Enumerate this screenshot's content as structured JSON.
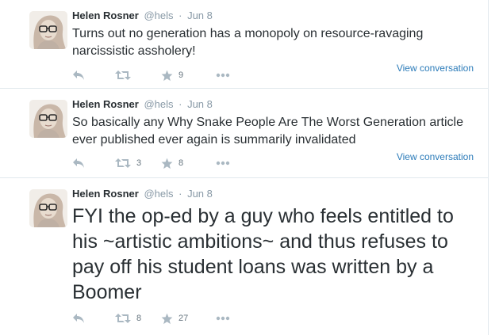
{
  "colors": {
    "name": "#292f33",
    "meta": "#8899a6",
    "link": "#2b7bb9",
    "action_icon": "#aab8c2",
    "divider": "#e1e8ed"
  },
  "tweets": [
    {
      "fullname": "Helen Rosner",
      "username": "@hels",
      "separator": "·",
      "time": "Jun 8",
      "text": "Turns out no generation has a monopoly on resource-ravaging narcissistic assholery!",
      "view_conversation": "View conversation",
      "actions": {
        "reply_icon": "reply-icon",
        "retweet_icon": "retweet-icon",
        "retweet_count": "",
        "favorite_icon": "star-icon",
        "favorite_count": "9",
        "more_icon": "more-dots-icon"
      }
    },
    {
      "fullname": "Helen Rosner",
      "username": "@hels",
      "separator": "·",
      "time": "Jun 8",
      "text": "So basically any Why Snake People Are The Worst Generation article ever published ever again is summarily invalidated",
      "view_conversation": "View conversation",
      "actions": {
        "reply_icon": "reply-icon",
        "retweet_icon": "retweet-icon",
        "retweet_count": "3",
        "favorite_icon": "star-icon",
        "favorite_count": "8",
        "more_icon": "more-dots-icon"
      }
    },
    {
      "fullname": "Helen Rosner",
      "username": "@hels",
      "separator": "·",
      "time": "Jun 8",
      "text": "FYI the op-ed by a guy who feels entitled to his ~artistic ambitions~ and thus refuses to pay off his student loans was written by a Boomer",
      "actions": {
        "reply_icon": "reply-icon",
        "retweet_icon": "retweet-icon",
        "retweet_count": "8",
        "favorite_icon": "star-icon",
        "favorite_count": "27",
        "more_icon": "more-dots-icon"
      }
    }
  ]
}
